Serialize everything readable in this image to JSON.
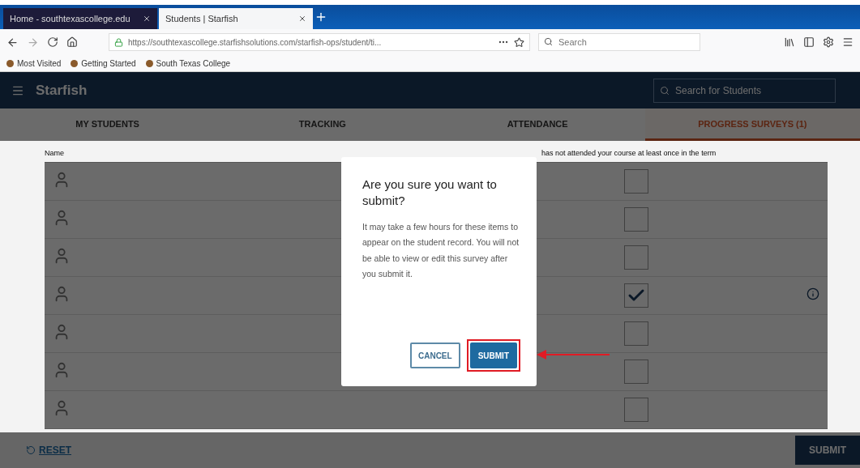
{
  "browser": {
    "tabs": [
      {
        "title": "Home - southtexascollege.edu",
        "selected": false
      },
      {
        "title": "Students | Starfish",
        "selected": true
      }
    ],
    "url": "https://southtexascollege.starfishsolutions.com/starfish-ops/student/ti...",
    "search": {
      "placeholder": "Search"
    },
    "bookmarks": [
      "Most Visited",
      "Getting Started",
      "South Texas College"
    ]
  },
  "app": {
    "title": "Starfish",
    "search": {
      "placeholder": "Search for Students"
    },
    "tabs": [
      {
        "label": "MY STUDENTS",
        "selected": false
      },
      {
        "label": "TRACKING",
        "selected": false
      },
      {
        "label": "ATTENDANCE",
        "selected": false
      },
      {
        "label": "PROGRESS SURVEYS (1)",
        "selected": true
      }
    ],
    "table": {
      "columns": [
        "Name",
        "has not attended your course at least once in the term"
      ],
      "rows": [
        {
          "checked": false,
          "info": false
        },
        {
          "checked": false,
          "info": false
        },
        {
          "checked": false,
          "info": false
        },
        {
          "checked": true,
          "info": true
        },
        {
          "checked": false,
          "info": false
        },
        {
          "checked": false,
          "info": false
        },
        {
          "checked": false,
          "info": false
        }
      ]
    },
    "reset": "RESET",
    "submit": "SUBMIT"
  },
  "dialog": {
    "title": "Are you sure you want to submit?",
    "message": "It may take a few hours for these items to appear on the student record. You will not be able to view or edit this survey after you submit it.",
    "buttons": [
      {
        "label": "CANCEL",
        "kind": "secondary",
        "highlighted": false
      },
      {
        "label": "SUBMIT",
        "kind": "primary",
        "highlighted": true
      }
    ]
  }
}
